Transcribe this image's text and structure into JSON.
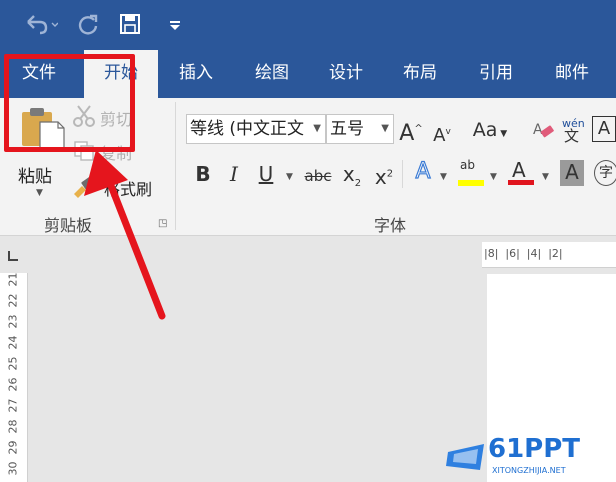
{
  "tabs": [
    {
      "label": "文件"
    },
    {
      "label": "开始"
    },
    {
      "label": "插入"
    },
    {
      "label": "绘图"
    },
    {
      "label": "设计"
    },
    {
      "label": "布局"
    },
    {
      "label": "引用"
    },
    {
      "label": "邮件"
    }
  ],
  "active_tab": "开始",
  "clipboard": {
    "paste_label": "粘贴",
    "cut_label": "剪切",
    "copy_label": "复制",
    "format_painter_label": "格式刷",
    "group_label": "剪贴板"
  },
  "font": {
    "font_name": "等线 (中文正文",
    "font_size": "五号",
    "group_label": "字体",
    "phonetic_label": "wén"
  },
  "vertical_ruler": [
    "21",
    "22",
    "23",
    "24",
    "25",
    "26",
    "27",
    "28",
    "29",
    "30"
  ],
  "horizontal_ruler": "|8|  |6|  |4|  |2|",
  "watermark": {
    "text": "61PPT",
    "subtext": "XITONGZHIJIA.NET"
  },
  "colors": {
    "brand": "#2b579a",
    "highlight_annotation": "#e5151d",
    "ribbon_bg": "#f3f3f3"
  }
}
